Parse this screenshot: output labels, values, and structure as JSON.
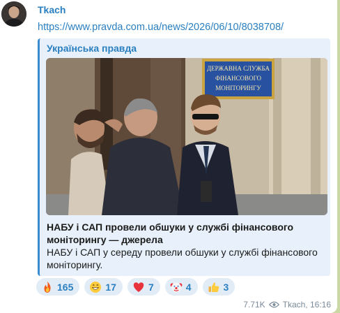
{
  "message": {
    "sender": "Tkach",
    "link_text": "https://www.pravda.com.ua/news/2026/06/10/8038708/",
    "views": "7.71K",
    "signature": "Tkach, 16:16"
  },
  "preview": {
    "site_name": "Українська правда",
    "photo_sign_text": [
      "ДЕРЖАВНА СЛУЖБА",
      "ФІНАНСОВОГО",
      "МОНІТОРИНГУ"
    ],
    "title": "НАБУ і САП провели обшуки у службі фінансового моніторингу — джерела",
    "description": "НАБУ і САП у середу провели обшуки у службі фінансового моніторингу."
  },
  "reactions": [
    {
      "icon": "fire-icon",
      "count": "165"
    },
    {
      "icon": "grinning-face-icon",
      "count": "17"
    },
    {
      "icon": "red-heart-icon",
      "count": "7"
    },
    {
      "icon": "clown-face-icon",
      "count": "4"
    },
    {
      "icon": "thumbs-up-icon",
      "count": "3"
    }
  ],
  "colors": {
    "accent": "#2a7fc1",
    "background": "#c9d8a4",
    "preview_bg": "#e8f1fb",
    "reaction_bg": "#e1ecf7"
  }
}
